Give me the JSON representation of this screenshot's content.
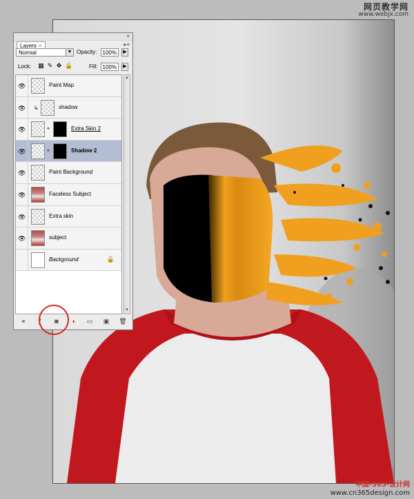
{
  "watermark": {
    "top_line1": "网页教学网",
    "top_line2": "www.webjx.com",
    "bottom_line1": "中国-365-设计网",
    "bottom_line2": "www.cn365design.com"
  },
  "panel": {
    "tab_label": "Layers",
    "tab_close": "×",
    "titlebar_close": "×",
    "menu_arrow": "▸≡",
    "blend_mode": "Normal",
    "opacity_label": "Opacity:",
    "opacity_value": "100%",
    "lock_label": "Lock:",
    "fill_label": "Fill:",
    "fill_value": "100%",
    "layers": [
      {
        "name": "Paint Map",
        "visible": true,
        "thumb": "checker"
      },
      {
        "name": "shadow",
        "visible": true,
        "thumb": "checker",
        "clipped": true
      },
      {
        "name": "Extra Skin 2",
        "visible": true,
        "thumb": "checker",
        "mask": true
      },
      {
        "name": "Shadow 2",
        "visible": true,
        "thumb": "checker",
        "mask": true,
        "selected": true
      },
      {
        "name": "Paint Background",
        "visible": true,
        "thumb": "checker"
      },
      {
        "name": "Faceless Subject",
        "visible": true,
        "thumb": "photo"
      },
      {
        "name": "Extra skin",
        "visible": true,
        "thumb": "checker"
      },
      {
        "name": "subject",
        "visible": true,
        "thumb": "photo"
      },
      {
        "name": "Background",
        "visible": false,
        "thumb": "white",
        "locked": true
      }
    ]
  },
  "colors": {
    "paint": "#f0a01e",
    "shirt_red": "#c0181e",
    "shirt_white": "#eeeeee",
    "annotation_circle": "#dd2222"
  }
}
